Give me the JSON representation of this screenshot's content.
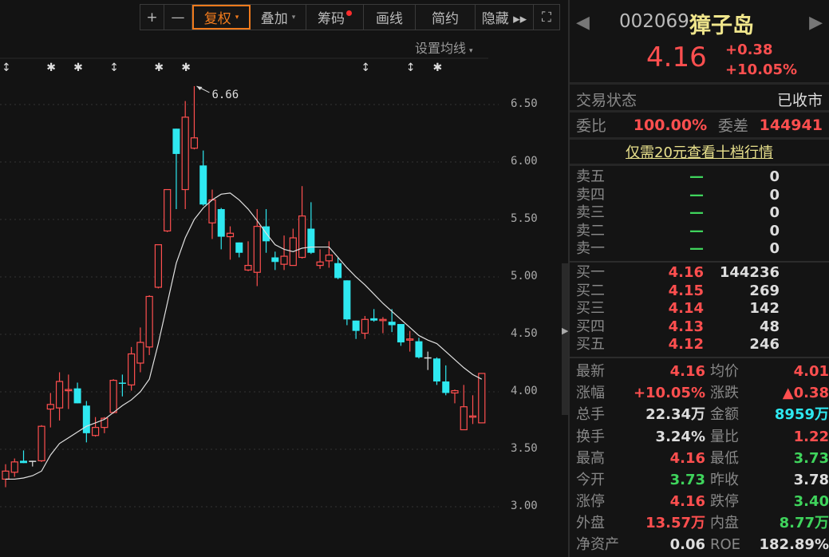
{
  "toolbar": {
    "items": [
      {
        "label": "+"
      },
      {
        "label": "—"
      },
      {
        "label": "复权",
        "caret": "▾"
      },
      {
        "label": "叠加",
        "caret": "▾"
      },
      {
        "label": "筹码"
      },
      {
        "label": "画线"
      },
      {
        "label": "简约"
      },
      {
        "label": "隐藏 ▸▸"
      },
      {
        "label": "⛶"
      }
    ]
  },
  "ma_setting": {
    "label": "设置均线",
    "caret": "▾"
  },
  "chart_data": {
    "type": "candlestick",
    "yticks": [
      "6.50",
      "6.00",
      "5.50",
      "5.00",
      "4.50",
      "4.00",
      "3.50",
      "3.00"
    ],
    "ylim": [
      3.0,
      6.5
    ],
    "max_annotation": "6.66",
    "colors": {
      "up": "#ff4f4f",
      "down": "#2ee8f0",
      "flat": "#dddddd",
      "ma": "#e0e0e0"
    },
    "candles": [
      [
        3.24,
        3.31,
        3.37,
        3.17
      ],
      [
        3.3,
        3.39,
        3.42,
        3.26
      ],
      [
        3.4,
        3.38,
        3.49,
        3.38
      ],
      [
        3.4,
        3.4,
        3.4,
        3.35
      ],
      [
        3.4,
        3.7,
        3.71,
        3.39
      ],
      [
        3.85,
        3.89,
        3.99,
        3.69
      ],
      [
        3.86,
        4.09,
        4.17,
        3.75
      ],
      [
        4.01,
        4.02,
        4.15,
        3.85
      ],
      [
        4.03,
        3.9,
        4.08,
        3.9
      ],
      [
        3.88,
        3.64,
        3.92,
        3.56
      ],
      [
        3.62,
        3.69,
        3.78,
        3.61
      ],
      [
        3.69,
        3.77,
        3.78,
        3.64
      ],
      [
        3.82,
        4.1,
        4.11,
        3.81
      ],
      [
        4.08,
        4.07,
        4.15,
        3.96
      ],
      [
        4.06,
        4.33,
        4.39,
        4.01
      ],
      [
        4.25,
        4.43,
        4.56,
        4.17
      ],
      [
        4.39,
        4.83,
        4.84,
        4.32
      ],
      [
        4.91,
        5.28,
        5.28,
        4.9
      ],
      [
        5.4,
        5.76,
        5.76,
        5.39
      ],
      [
        6.29,
        6.07,
        6.29,
        5.59
      ],
      [
        5.76,
        6.39,
        6.53,
        5.59
      ],
      [
        6.12,
        6.21,
        6.66,
        6.11
      ],
      [
        5.97,
        5.63,
        6.1,
        5.62
      ],
      [
        5.47,
        5.67,
        5.76,
        5.33
      ],
      [
        5.59,
        5.35,
        5.6,
        5.24
      ],
      [
        5.35,
        5.38,
        5.44,
        5.15
      ],
      [
        5.3,
        5.21,
        5.3,
        5.17
      ],
      [
        5.06,
        5.1,
        5.31,
        5.05
      ],
      [
        5.04,
        5.44,
        5.59,
        4.92
      ],
      [
        5.44,
        5.31,
        5.59,
        5.21
      ],
      [
        5.17,
        5.13,
        5.22,
        5.06
      ],
      [
        5.11,
        5.18,
        5.36,
        5.06
      ],
      [
        5.1,
        5.34,
        5.42,
        5.1
      ],
      [
        5.17,
        5.53,
        5.79,
        5.16
      ],
      [
        5.42,
        5.21,
        5.65,
        5.2
      ],
      [
        5.1,
        5.13,
        5.24,
        5.07
      ],
      [
        5.14,
        5.19,
        5.31,
        5.08
      ],
      [
        5.12,
        4.99,
        5.17,
        4.98
      ],
      [
        4.97,
        4.63,
        4.97,
        4.58
      ],
      [
        4.62,
        4.53,
        4.62,
        4.46
      ],
      [
        4.51,
        4.63,
        4.66,
        4.46
      ],
      [
        4.64,
        4.62,
        4.72,
        4.61
      ],
      [
        4.62,
        4.63,
        4.65,
        4.51
      ],
      [
        4.61,
        4.58,
        4.72,
        4.52
      ],
      [
        4.59,
        4.43,
        4.59,
        4.4
      ],
      [
        4.45,
        4.46,
        4.53,
        4.35
      ],
      [
        4.44,
        4.3,
        4.47,
        4.29
      ],
      [
        4.3,
        4.3,
        4.35,
        4.19
      ],
      [
        4.29,
        4.09,
        4.3,
        4.06
      ],
      [
        4.09,
        3.99,
        4.23,
        3.97
      ],
      [
        3.99,
        4.01,
        4.02,
        3.9
      ],
      [
        3.67,
        3.87,
        4.06,
        3.67
      ],
      [
        3.78,
        3.79,
        3.97,
        3.72
      ],
      [
        3.73,
        4.16,
        4.16,
        3.73
      ]
    ],
    "ma": [
      3.24,
      3.24,
      3.25,
      3.27,
      3.31,
      3.45,
      3.55,
      3.6,
      3.65,
      3.7,
      3.73,
      3.76,
      3.82,
      3.88,
      3.93,
      4.0,
      4.11,
      4.42,
      4.77,
      5.12,
      5.34,
      5.5,
      5.6,
      5.67,
      5.72,
      5.73,
      5.67,
      5.59,
      5.49,
      5.38,
      5.28,
      5.24,
      5.22,
      5.25,
      5.26,
      5.26,
      5.26,
      5.17,
      5.08,
      5.0,
      4.93,
      4.85,
      4.77,
      4.7,
      4.63,
      4.56,
      4.49,
      4.45,
      4.42,
      4.35,
      4.28,
      4.21,
      4.15,
      4.11
    ],
    "event_markers": [
      {
        "index": 0,
        "glyph": "↕"
      },
      {
        "index": 5,
        "glyph": "✱"
      },
      {
        "index": 8,
        "glyph": "✱"
      },
      {
        "index": 12,
        "glyph": "↕"
      },
      {
        "index": 17,
        "glyph": "✱"
      },
      {
        "index": 20,
        "glyph": "✱"
      },
      {
        "index": 40,
        "glyph": "↕"
      },
      {
        "index": 45,
        "glyph": "↕"
      },
      {
        "index": 48,
        "glyph": "✱"
      }
    ]
  },
  "quote": {
    "code": "002069",
    "name": "獐子岛",
    "price": "4.16",
    "change": "+0.38",
    "change_pct": "+10.05%",
    "status_label": "交易状态",
    "status": "已收市",
    "wb_label": "委比",
    "wb": "100.00%",
    "wc_label": "委差",
    "wc": "144941",
    "upsell_link": "仅需20元查看十档行情"
  },
  "asks": [
    {
      "label": "卖五",
      "price": "—",
      "vol": "0"
    },
    {
      "label": "卖四",
      "price": "—",
      "vol": "0"
    },
    {
      "label": "卖三",
      "price": "—",
      "vol": "0"
    },
    {
      "label": "卖二",
      "price": "—",
      "vol": "0"
    },
    {
      "label": "卖一",
      "price": "—",
      "vol": "0"
    }
  ],
  "bids": [
    {
      "label": "买一",
      "price": "4.16",
      "vol": "144236"
    },
    {
      "label": "买二",
      "price": "4.15",
      "vol": "269"
    },
    {
      "label": "买三",
      "price": "4.14",
      "vol": "142"
    },
    {
      "label": "买四",
      "price": "4.13",
      "vol": "48"
    },
    {
      "label": "买五",
      "price": "4.12",
      "vol": "246"
    }
  ],
  "stats": [
    {
      "l1": "最新",
      "v1": "4.16",
      "c1": "red",
      "l2": "均价",
      "v2": "4.01",
      "c2": "red"
    },
    {
      "l1": "涨幅",
      "v1": "+10.05%",
      "c1": "red",
      "l2": "涨跌",
      "v2": "▲0.38",
      "c2": "red"
    },
    {
      "l1": "总手",
      "v1": "22.34万",
      "c1": "white",
      "l2": "金额",
      "v2": "8959万",
      "c2": "cyan"
    },
    {
      "l1": "换手",
      "v1": "3.24%",
      "c1": "white",
      "l2": "量比",
      "v2": "1.22",
      "c2": "red"
    },
    {
      "l1": "最高",
      "v1": "4.16",
      "c1": "red",
      "l2": "最低",
      "v2": "3.73",
      "c2": "green"
    },
    {
      "l1": "今开",
      "v1": "3.73",
      "c1": "green",
      "l2": "昨收",
      "v2": "3.78",
      "c2": "white"
    },
    {
      "l1": "涨停",
      "v1": "4.16",
      "c1": "red",
      "l2": "跌停",
      "v2": "3.40",
      "c2": "green"
    },
    {
      "l1": "外盘",
      "v1": "13.57万",
      "c1": "red",
      "l2": "内盘",
      "v2": "8.77万",
      "c2": "green"
    },
    {
      "l1": "净资产",
      "v1": "0.06",
      "c1": "white",
      "l2": "ROE",
      "v2": "182.89%",
      "c2": "white"
    }
  ]
}
